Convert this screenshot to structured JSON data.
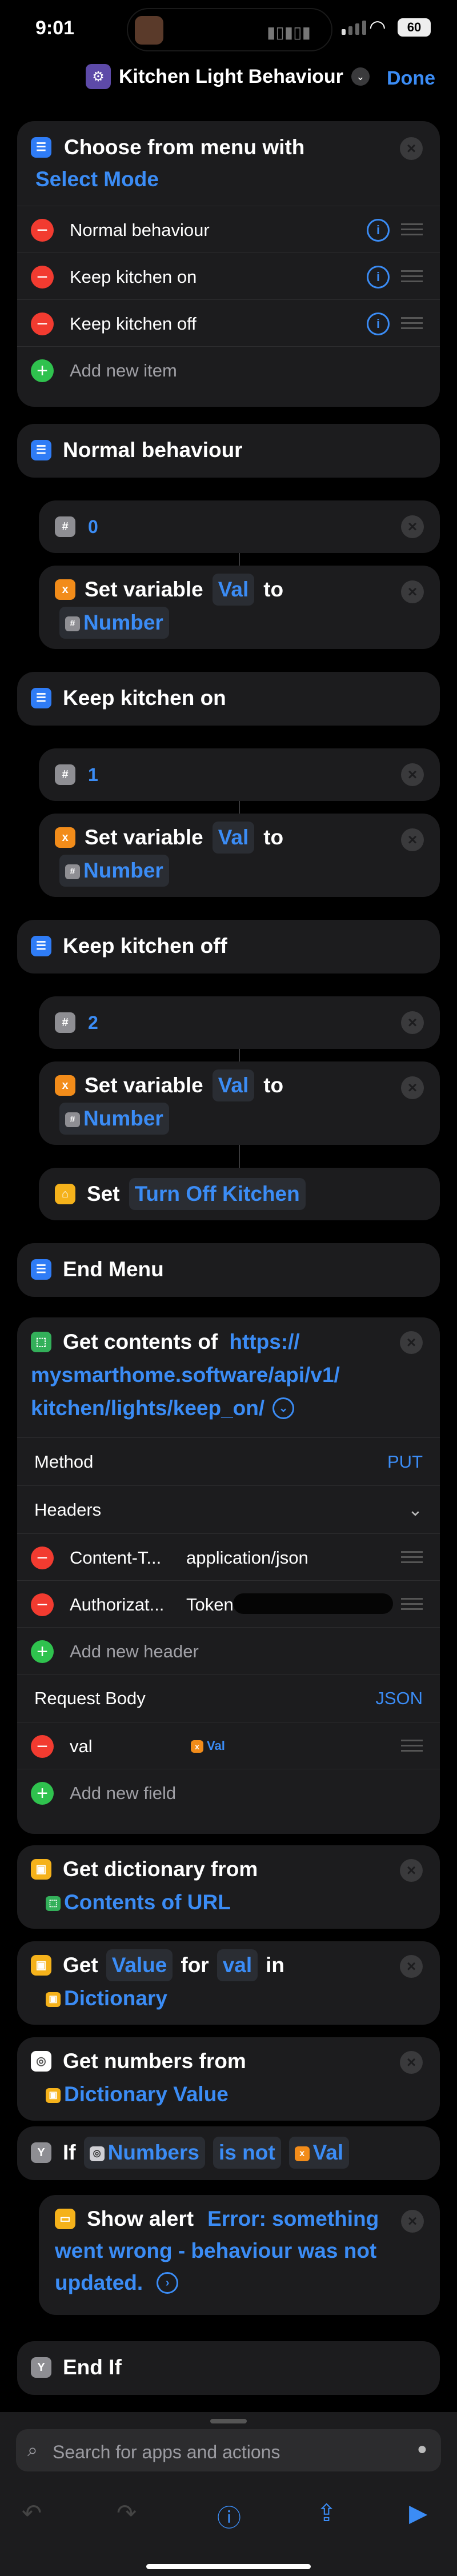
{
  "status": {
    "time": "9:01",
    "battery": "60"
  },
  "nav": {
    "title": "Kitchen Light Behaviour",
    "done": "Done"
  },
  "menu": {
    "prefix": "Choose from menu with",
    "prompt": "Select Mode",
    "items": [
      "Normal behaviour",
      "Keep kitchen on",
      "Keep kitchen off"
    ],
    "add_item": "Add new item"
  },
  "cases": [
    {
      "title": "Normal behaviour",
      "number": "0"
    },
    {
      "title": "Keep kitchen on",
      "number": "1"
    },
    {
      "title": "Keep kitchen off",
      "number": "2"
    }
  ],
  "set_variable": {
    "label": "Set variable",
    "var": "Val",
    "to": "to",
    "value": "Number"
  },
  "set_action": {
    "label": "Set",
    "target": "Turn Off Kitchen"
  },
  "end_menu": "End Menu",
  "get_contents": {
    "label": "Get contents of",
    "url_line1": "https://",
    "url_line2": "mysmarthome.software/api/v1/",
    "url_line3": "kitchen/lights/keep_on/",
    "method_label": "Method",
    "method_value": "PUT",
    "headers_label": "Headers",
    "headers": [
      {
        "key": "Content-T...",
        "value": "application/json"
      },
      {
        "key": "Authorizat...",
        "value": "Token"
      }
    ],
    "add_header": "Add new header",
    "body_label": "Request Body",
    "body_type": "JSON",
    "fields": [
      {
        "key": "val",
        "value": "Val"
      }
    ],
    "add_field": "Add new field"
  },
  "get_dict": {
    "label": "Get dictionary from",
    "source": "Contents of URL"
  },
  "get_value": {
    "get": "Get",
    "value": "Value",
    "for": "for",
    "key": "val",
    "in": "in",
    "source": "Dictionary"
  },
  "get_numbers": {
    "label": "Get numbers from",
    "source": "Dictionary Value"
  },
  "if_block": {
    "label": "If",
    "input": "Numbers",
    "condition": "is not",
    "compare": "Val"
  },
  "alert": {
    "label": "Show alert",
    "line1": "Error: something",
    "line2": "went wrong - behaviour was not",
    "line3": "updated."
  },
  "end_if": "End If",
  "search": {
    "placeholder": "Search for apps and actions"
  },
  "icons": {
    "accent": "#3b8cf5",
    "destructive": "#f23b30",
    "add": "#2fc24e"
  }
}
